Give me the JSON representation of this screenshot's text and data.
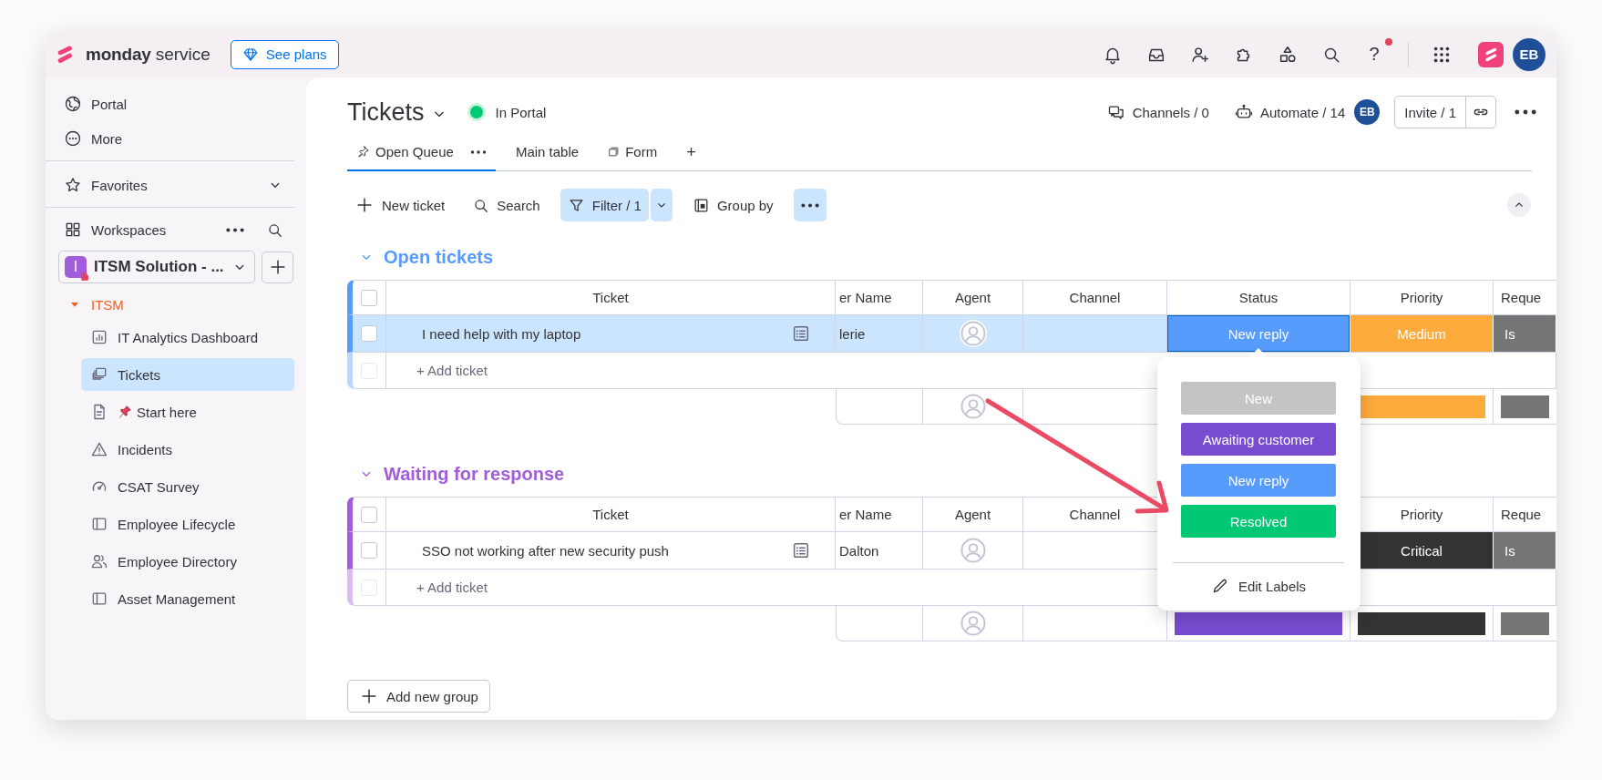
{
  "topbar": {
    "brand": "monday",
    "product": "service",
    "plans_button": "See plans",
    "help": "?",
    "help_notification": true,
    "avatar": "EB"
  },
  "sidebar": {
    "nav": [
      {
        "label": "Portal",
        "kind": "globe"
      },
      {
        "label": "More",
        "kind": "more"
      }
    ],
    "favorites": {
      "label": "Favorites",
      "expanded": false
    },
    "workspaces": {
      "label": "Workspaces"
    },
    "workspace": {
      "initial": "I",
      "name": "ITSM Solution - ...",
      "locked": true
    },
    "tree": [
      {
        "label": "ITSM",
        "expanded": true,
        "children": [
          {
            "label": "IT Analytics Dashboard",
            "kind": "dashboard",
            "selected": false
          },
          {
            "label": "Tickets",
            "kind": "boards",
            "selected": true
          },
          {
            "label": "Start here",
            "kind": "doc",
            "pinned": true,
            "selected": false
          },
          {
            "label": "Incidents",
            "kind": "warning",
            "selected": false
          },
          {
            "label": "CSAT Survey",
            "kind": "gauge",
            "selected": false
          },
          {
            "label": "Employee Lifecycle",
            "kind": "board",
            "selected": false
          },
          {
            "label": "Employee Directory",
            "kind": "people",
            "selected": false
          },
          {
            "label": "Asset Management",
            "kind": "board",
            "selected": false
          }
        ]
      }
    ]
  },
  "board": {
    "title": "Tickets",
    "status": "In Portal",
    "channels": "Channels / 0",
    "automate": "Automate / 14",
    "avatar": "EB",
    "invite": "Invite / 1"
  },
  "views": [
    {
      "label": "Open Queue",
      "kind": "pinned",
      "selected": true
    },
    {
      "label": "Main table",
      "kind": "table",
      "selected": false
    },
    {
      "label": "Form",
      "kind": "form",
      "selected": false
    }
  ],
  "add_view": "+",
  "toolbar": [
    {
      "label": "New ticket",
      "kind": "new",
      "active": false
    },
    {
      "label": "Search",
      "kind": "search",
      "active": false
    },
    {
      "label": "Filter / 1",
      "kind": "filter",
      "active": true
    },
    {
      "label": "Group by",
      "kind": "group",
      "active": false
    },
    {
      "kind": "more",
      "active": true
    }
  ],
  "groups": [
    {
      "title": "Open tickets",
      "color": "#579bfc",
      "expanded": true,
      "columns": [
        {
          "kind": "ticket",
          "label": "Ticket"
        },
        {
          "kind": "customer",
          "label": "er Name"
        },
        {
          "kind": "agent",
          "label": "Agent"
        },
        {
          "kind": "channel",
          "label": "Channel"
        },
        {
          "kind": "status",
          "label": "Status"
        },
        {
          "kind": "priority",
          "label": "Priority"
        },
        {
          "kind": "request",
          "label": "Reque"
        }
      ],
      "header_checked": false,
      "rows": [
        {
          "selected": true,
          "checked": false,
          "ticket": "I need help with my laptop",
          "customer": "lerie",
          "status": {
            "label": "New reply",
            "color": "#579bfc"
          },
          "priority": {
            "label": "Medium",
            "color": "#fdab3d"
          },
          "request": {
            "label": "Is",
            "color": "#757575"
          }
        }
      ],
      "add_item": "+ Add ticket",
      "add_checked": false,
      "summary": [
        {
          "kind": "priority",
          "color": "#fdab3d"
        },
        {
          "kind": "request",
          "color": "#757575"
        }
      ]
    },
    {
      "title": "Waiting for response",
      "color": "#a25ddc",
      "expanded": true,
      "columns": [
        {
          "kind": "ticket",
          "label": "Ticket"
        },
        {
          "kind": "customer",
          "label": "er Name"
        },
        {
          "kind": "agent",
          "label": "Agent"
        },
        {
          "kind": "channel",
          "label": "Channel"
        },
        {
          "kind": "status"
        },
        {
          "kind": "priority",
          "label": "Priority"
        },
        {
          "kind": "request",
          "label": "Reque"
        }
      ],
      "header_checked": false,
      "rows": [
        {
          "selected": false,
          "checked": false,
          "ticket": "SSO not working after new security push",
          "customer": "Dalton",
          "priority": {
            "label": "Critical",
            "color": "#333333"
          },
          "request": {
            "label": "Is",
            "color": "#757575"
          }
        }
      ],
      "add_item": "+ Add ticket",
      "add_checked": false,
      "summary": [
        {
          "kind": "status",
          "color": "#784bd1"
        },
        {
          "kind": "priority",
          "color": "#333333"
        },
        {
          "kind": "request",
          "color": "#757575"
        }
      ]
    }
  ],
  "status_menu": {
    "options": [
      {
        "label": "New",
        "color": "#c4c4c4"
      },
      {
        "label": "Awaiting customer",
        "color": "#784bd1"
      },
      {
        "label": "New reply",
        "color": "#579bfc"
      },
      {
        "label": "Resolved",
        "color": "#00c875"
      }
    ],
    "edit": "Edit Labels"
  },
  "add_group": "Add new group"
}
